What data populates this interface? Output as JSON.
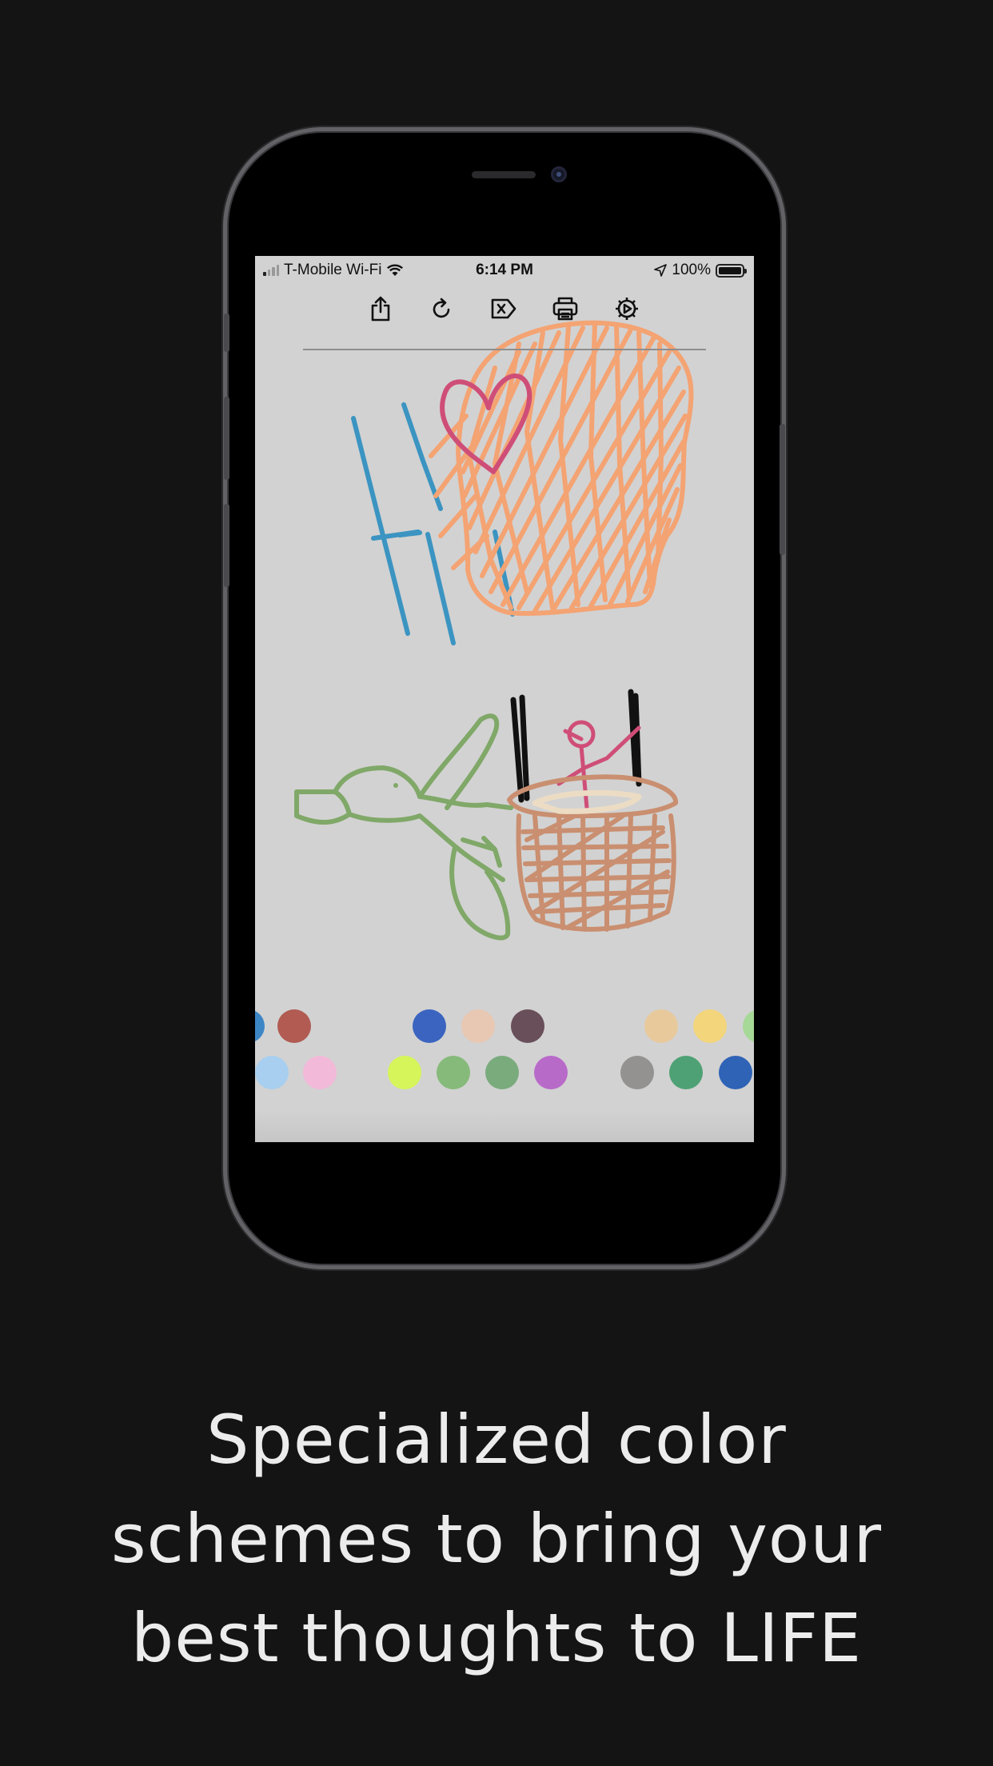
{
  "status_bar": {
    "carrier": "T-Mobile Wi-Fi",
    "time": "6:14 PM",
    "battery": "100%",
    "signal_bars": 1,
    "battery_level": 1.0
  },
  "toolbar": {
    "icons": [
      "share-icon",
      "redo-icon",
      "clear-icon",
      "print-icon",
      "settings-icon"
    ]
  },
  "palette": {
    "row1": [
      "#3d86c6",
      "#b15b52",
      "#3a64c0",
      "#e8c7b3",
      "#684f5a",
      "#e8c99c",
      "#f3d57c",
      "#a6d897"
    ],
    "row2": [
      "#a8cfef",
      "#f2b9d8",
      "#d6f55a",
      "#86ba7a",
      "#7aab7d",
      "#b86ac9",
      "#949290",
      "#4ea174",
      "#2f63b6"
    ]
  },
  "caption": {
    "line1": "Specialized color",
    "line2": "schemes to bring your",
    "line3": "best thoughts to LIFE"
  },
  "colors": {
    "background": "#141415",
    "screen": "#d2d2d2",
    "stroke_blue": "#3b94c1",
    "stroke_orange": "#f4a373",
    "stroke_pink": "#cf4e78",
    "stroke_green": "#80a868",
    "stroke_brown": "#c98f70",
    "stroke_black": "#111111"
  }
}
